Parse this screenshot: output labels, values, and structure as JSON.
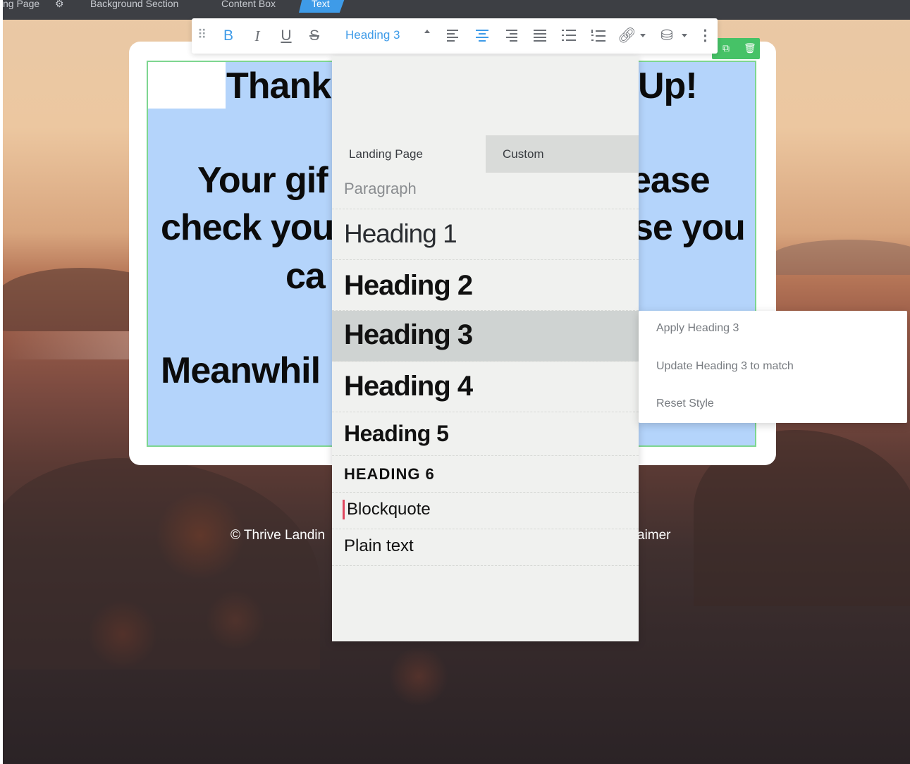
{
  "breadcrumbs": {
    "landing_page": "ng Page",
    "background_section": "Background Section",
    "content_box": "Content Box",
    "text": "Text"
  },
  "canvas": {
    "lines": [
      "Thank",
      "Up!",
      "Your gif",
      "ease",
      "check you",
      "se you",
      "ca",
      "Meanwhil"
    ],
    "footer": {
      "left": "© Thrive Landin",
      "right": "aimer"
    }
  },
  "toolbar": {
    "bold": "B",
    "italic": "I",
    "underline": "U",
    "strikethrough": "S",
    "heading_select": "Heading 3",
    "more": "⋮",
    "accent_color": "#3e9be8"
  },
  "style_dropdown": {
    "tabs": [
      "Landing Page",
      "Custom"
    ],
    "active_tab": "Custom",
    "items": [
      "Paragraph",
      "Heading 1",
      "Heading 2",
      "Heading 3",
      "Heading 4",
      "Heading 5",
      "HEADING 6",
      "Blockquote",
      "Plain text"
    ],
    "selected": "Heading 3"
  },
  "context_menu": {
    "items": [
      "Apply Heading 3",
      "Update Heading 3 to match",
      "Reset Style"
    ]
  },
  "colors": {
    "text_element_bg": "#b4d4fb",
    "element_border": "#7ed690",
    "blockquote_bar": "#e0465e"
  }
}
